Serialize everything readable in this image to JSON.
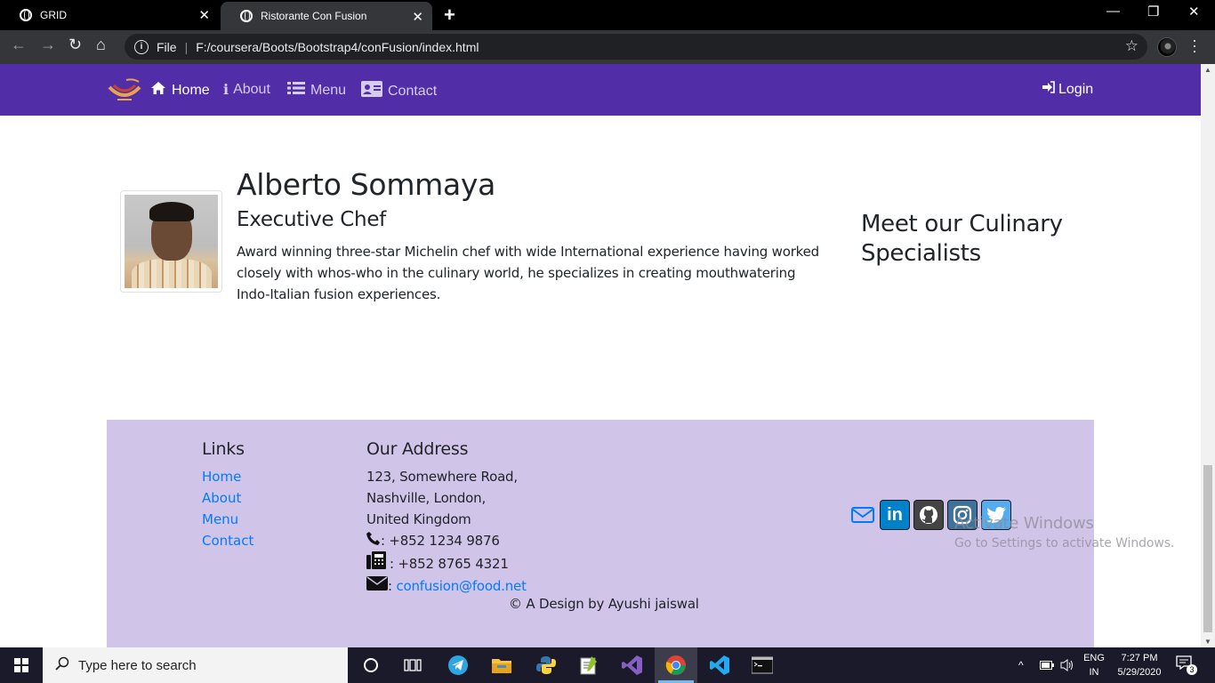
{
  "browser": {
    "tabs": [
      {
        "title": "GRID",
        "active": false
      },
      {
        "title": "Ristorante Con Fusion",
        "active": true
      }
    ],
    "url_scheme_label": "File",
    "url": "F:/coursera/Boots/Bootstrap4/conFusion/index.html"
  },
  "navbar": {
    "items": [
      {
        "label": "Home",
        "icon": "home-icon",
        "active": true
      },
      {
        "label": "About",
        "icon": "info-icon",
        "active": false
      },
      {
        "label": "Menu",
        "icon": "list-icon",
        "active": false
      },
      {
        "label": "Contact",
        "icon": "address-card-icon",
        "active": false
      }
    ],
    "login_label": "Login",
    "brand_color": "#512da8"
  },
  "chef": {
    "name": "Alberto Sommaya",
    "title": "Executive Chef",
    "description": "Award winning three-star Michelin chef with wide International experience having worked closely with whos-who in the culinary world, he specializes in creating mouthwatering Indo-Italian fusion experiences."
  },
  "specialists_heading": "Meet our Culinary Specialists",
  "footer": {
    "background": "#d1c4e9",
    "links_heading": "Links",
    "links": [
      "Home",
      "About",
      "Menu",
      "Contact"
    ],
    "address_heading": "Our Address",
    "address_lines": [
      "123, Somewhere Road,",
      "Nashville, London,",
      "United Kingdom"
    ],
    "phone": ": +852 1234 9876",
    "fax": ": +852 8765 4321",
    "email_prefix": ":",
    "email": "confusion@food.net",
    "copyright": "© A Design by Ayushi jaiswal",
    "social": [
      "envelope-icon",
      "linkedin-icon",
      "github-icon",
      "instagram-icon",
      "twitter-icon"
    ]
  },
  "watermark": {
    "line1": "Activate Windows",
    "line2": "Go to Settings to activate Windows."
  },
  "taskbar": {
    "search_placeholder": "Type here to search",
    "lang_top": "ENG",
    "lang_bottom": "IN",
    "time": "7:27 PM",
    "date": "5/29/2020",
    "notification_count": "3"
  }
}
